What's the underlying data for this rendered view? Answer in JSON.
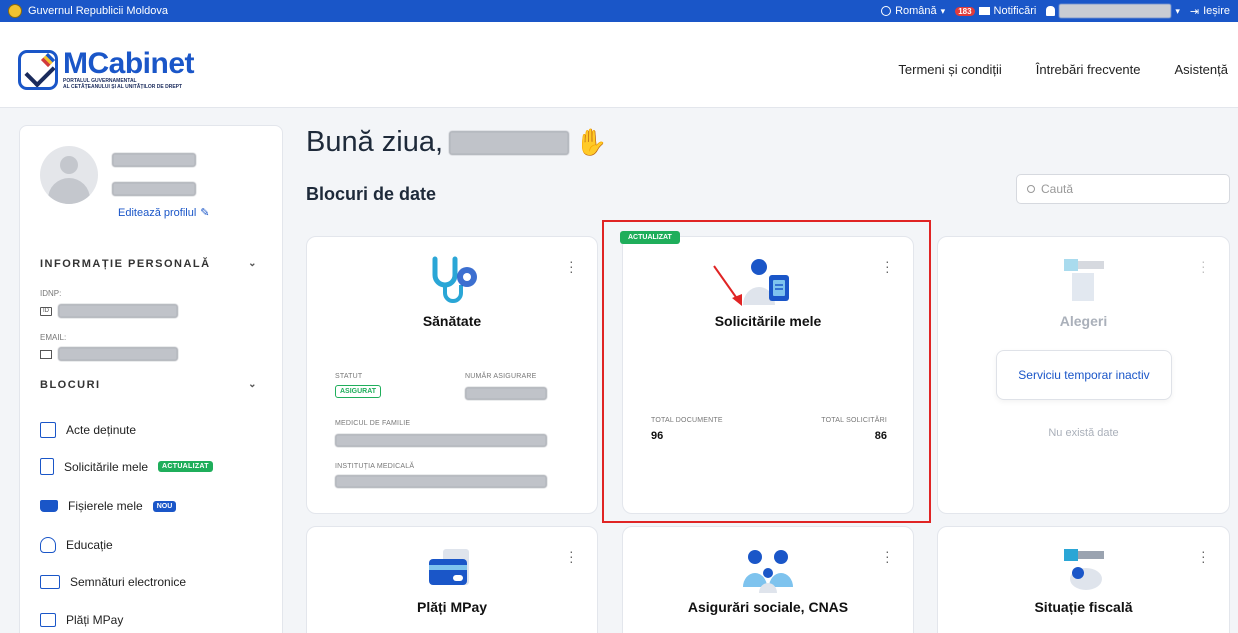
{
  "gov_bar": {
    "title": "Guvernul Republicii Moldova",
    "language": "Română",
    "notif_count": "183",
    "notif_label": "Notificări",
    "exit_label": "Ieșire"
  },
  "header": {
    "logo_main": "MCabinet",
    "logo_sub_1": "PORTALUL GUVERNAMENTAL",
    "logo_sub_2": "AL CETĂȚEANULUI ȘI AL UNITĂȚILOR DE DREPT",
    "nav": [
      "Termeni și condiții",
      "Întrebări frecvente",
      "Asistență"
    ]
  },
  "sidebar": {
    "edit_profile": "Editează profilul",
    "personal_heading": "INFORMAȚIE PERSONALĂ",
    "idnp_label": "IDNP:",
    "email_label": "EMAIL:",
    "blocks_heading": "BLOCURI",
    "items": [
      {
        "label": "Acte deținute",
        "icon": "id-card-icon"
      },
      {
        "label": "Solicitările mele",
        "icon": "document-icon",
        "tag": "ACTUALIZAT"
      },
      {
        "label": "Fișierele mele",
        "icon": "tray-icon",
        "tag": "NOU"
      },
      {
        "label": "Educație",
        "icon": "graduation-icon"
      },
      {
        "label": "Semnături electronice",
        "icon": "signature-icon"
      },
      {
        "label": "Plăți MPay",
        "icon": "payment-icon"
      }
    ]
  },
  "main": {
    "greeting": "Bună ziua,",
    "blocks_title": "Blocuri de date",
    "search_placeholder": "Caută",
    "cards": {
      "sanatate": {
        "title": "Sănătate",
        "statut_label": "STATUT",
        "statut_value": "ASIGURAT",
        "nr_label": "NUMĂR ASIGURARE",
        "medic_label": "MEDICUL DE FAMILIE",
        "inst_label": "INSTITUȚIA MEDICALĂ"
      },
      "solicitari": {
        "tag": "ACTUALIZAT",
        "title": "Solicitările mele",
        "docs_label": "TOTAL DOCUMENTE",
        "docs_value": "96",
        "sol_label": "TOTAL SOLICITĂRI",
        "sol_value": "86"
      },
      "alegeri": {
        "title": "Alegeri",
        "inactive": "Serviciu temporar inactiv",
        "no_data": "Nu există date"
      },
      "plati": {
        "title": "Plăți MPay"
      },
      "cnas": {
        "title": "Asigurări sociale, CNAS"
      },
      "fiscal": {
        "title": "Situație fiscală"
      }
    }
  },
  "colors": {
    "primary": "#1a56c8",
    "green": "#1fae5b",
    "highlight": "#e02424"
  }
}
